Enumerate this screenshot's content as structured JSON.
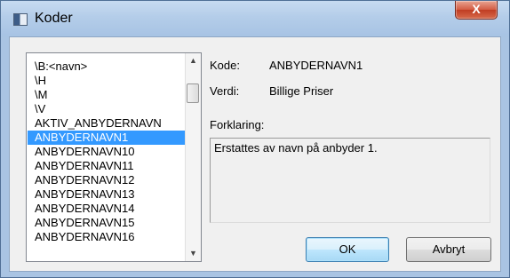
{
  "window": {
    "title": "Koder",
    "close_label": "X"
  },
  "list": {
    "items": [
      "\\B:<navn>",
      "\\H",
      "\\M",
      "\\V",
      "AKTIV_ANBYDERNAVN",
      "ANBYDERNAVN1",
      "ANBYDERNAVN10",
      "ANBYDERNAVN11",
      "ANBYDERNAVN12",
      "ANBYDERNAVN13",
      "ANBYDERNAVN14",
      "ANBYDERNAVN15",
      "ANBYDERNAVN16"
    ],
    "selected_index": 5
  },
  "details": {
    "kode_label": "Kode:",
    "kode_value": "ANBYDERNAVN1",
    "verdi_label": "Verdi:",
    "verdi_value": "Billige Priser",
    "forklaring_label": "Forklaring:",
    "forklaring_text": "Erstattes av navn på anbyder 1."
  },
  "buttons": {
    "ok_label": "OK",
    "cancel_label": "Avbryt"
  },
  "icons": {
    "window_icon": "window-app-icon",
    "scroll_up": "chevron-up-icon",
    "scroll_down": "chevron-down-icon"
  }
}
